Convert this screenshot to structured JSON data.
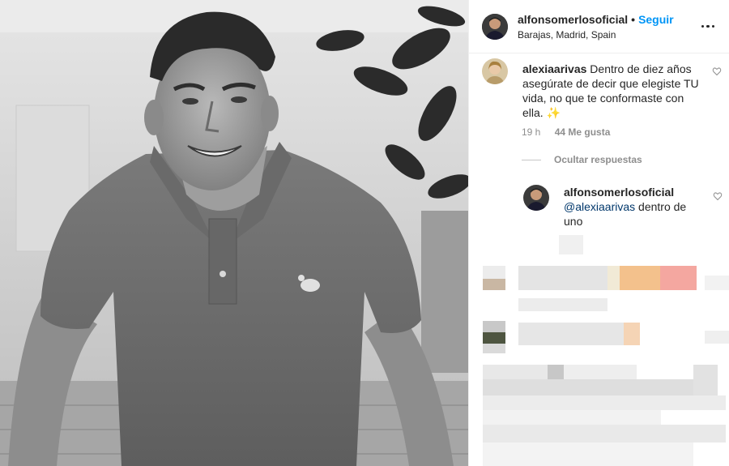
{
  "header": {
    "username": "alfonsomerlosoficial",
    "separator": "•",
    "follow_label": "Seguir",
    "location": "Barajas, Madrid, Spain",
    "more_icon": "ellipsis-icon"
  },
  "comment": {
    "username": "alexiaarivas",
    "text": "Dentro de diez años asegúrate de decir que elegiste TU vida, no que te conformaste con ella. ✨",
    "time": "19 h",
    "likes": "44 Me gusta",
    "hide_replies": "Ocultar respuestas"
  },
  "reply": {
    "username": "alfonsomerlosoficial",
    "mention": "@alexiaarivas",
    "text": "dentro de uno"
  },
  "colors": {
    "accent": "#0095f6",
    "text": "#262626",
    "muted": "#8e8e8e",
    "mention": "#00376b"
  }
}
